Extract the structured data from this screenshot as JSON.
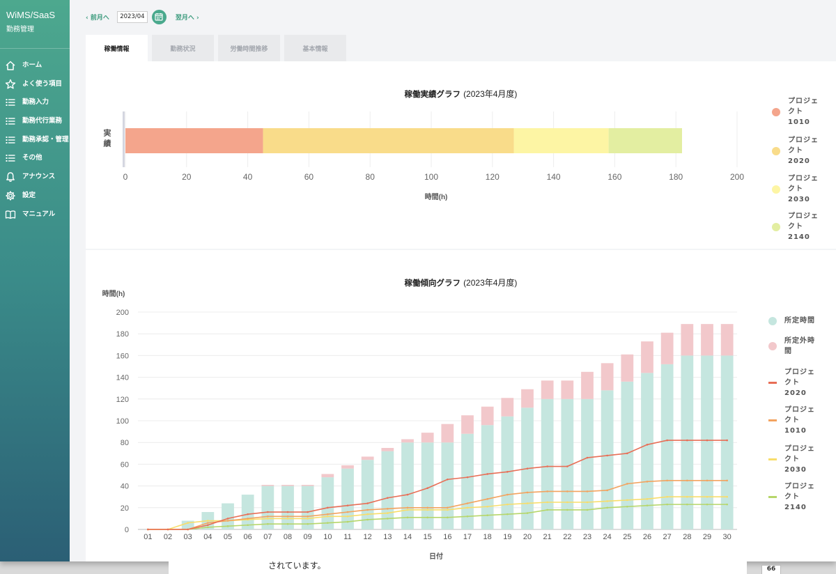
{
  "app": {
    "brand": "WiMS/SaaS",
    "subtitle": "勤務管理"
  },
  "sidebar": {
    "items": [
      {
        "label": "ホーム",
        "icon": "home-icon"
      },
      {
        "label": "よく使う項目",
        "icon": "star-icon"
      },
      {
        "label": "勤務入力",
        "icon": "list-icon"
      },
      {
        "label": "勤務代行業務",
        "icon": "list-icon"
      },
      {
        "label": "勤務承認・管理",
        "icon": "list-icon"
      },
      {
        "label": "その他",
        "icon": "list-icon"
      },
      {
        "label": "アナウンス",
        "icon": "bell-icon"
      },
      {
        "label": "設定",
        "icon": "gear-icon"
      },
      {
        "label": "マニュアル",
        "icon": "book-icon"
      }
    ]
  },
  "topbar": {
    "prev": "前月へ",
    "month": "2023/04",
    "next": "翌月へ"
  },
  "tabs": [
    "稼働情報",
    "勤務状況",
    "労働時間推移",
    "基本情報"
  ],
  "colors": {
    "accent": "#4aa98d",
    "p1010": "#f4a58c",
    "p2020": "#f9dc8a",
    "p2030": "#fdf5a4",
    "p2140": "#e3eea1",
    "scheduled": "#c5e6df",
    "overtime": "#f2c8cb"
  },
  "chart_data": [
    {
      "type": "bar",
      "orientation": "horizontal",
      "stacked": true,
      "title_bold": "稼働実績グラフ",
      "title_rest": "(2023年4月度)",
      "categories": [
        "実績"
      ],
      "series": [
        {
          "name": "プロジェクト1010",
          "values": [
            45
          ]
        },
        {
          "name": "プロジェクト2020",
          "values": [
            82
          ]
        },
        {
          "name": "プロジェクト2030",
          "values": [
            31
          ]
        },
        {
          "name": "プロジェクト2140",
          "values": [
            24
          ]
        }
      ],
      "xlabel": "時間(h)",
      "xlim": [
        0,
        200
      ],
      "xticks": [
        0,
        20,
        40,
        60,
        80,
        100,
        120,
        140,
        160,
        180,
        200
      ],
      "legend": "right"
    },
    {
      "type": "bar+line",
      "title_bold": "稼働傾向グラフ",
      "title_rest": "(2023年4月度)",
      "ylabel": "時間(h)",
      "xlabel": "日付",
      "ylim": [
        0,
        200
      ],
      "yticks": [
        0,
        20,
        40,
        60,
        80,
        100,
        120,
        140,
        160,
        180,
        200
      ],
      "categories": [
        "01",
        "02",
        "03",
        "04",
        "05",
        "06",
        "07",
        "08",
        "09",
        "10",
        "11",
        "12",
        "13",
        "14",
        "15",
        "16",
        "17",
        "18",
        "19",
        "20",
        "21",
        "22",
        "23",
        "24",
        "25",
        "26",
        "27",
        "28",
        "29",
        "30"
      ],
      "bars": [
        {
          "name": "所定時間",
          "values": [
            0,
            0,
            8,
            16,
            24,
            32,
            40,
            40,
            40,
            48,
            56,
            64,
            72,
            80,
            80,
            80,
            88,
            96,
            104,
            112,
            120,
            120,
            120,
            128,
            136,
            144,
            152,
            160,
            160,
            160
          ]
        },
        {
          "name": "所定外時間",
          "values": [
            0,
            0,
            0,
            0,
            0,
            0,
            1,
            1,
            1,
            3,
            3,
            3,
            3,
            3,
            9,
            17,
            17,
            17,
            17,
            17,
            17,
            17,
            25,
            25,
            25,
            29,
            29,
            29,
            29,
            29
          ]
        }
      ],
      "lines": [
        {
          "name": "プロジェクト2020",
          "values": [
            0,
            0,
            0,
            4,
            10,
            14,
            16,
            16,
            16,
            20,
            22,
            24,
            29,
            32,
            38,
            46,
            48,
            51,
            53,
            56,
            58,
            58,
            66,
            68,
            70,
            78,
            82,
            82,
            82,
            82
          ]
        },
        {
          "name": "プロジェクト1010",
          "values": [
            0,
            0,
            0,
            6,
            8,
            10,
            12,
            12,
            12,
            14,
            16,
            18,
            19,
            20,
            20,
            20,
            24,
            28,
            32,
            34,
            35,
            35,
            35,
            36,
            42,
            44,
            45,
            45,
            45,
            45
          ]
        },
        {
          "name": "プロジェクト2030",
          "values": [
            0,
            0,
            6,
            8,
            8,
            9,
            10,
            10,
            10,
            12,
            12,
            14,
            15,
            18,
            18,
            18,
            20,
            21,
            23,
            24,
            25,
            25,
            25,
            26,
            27,
            28,
            30,
            30,
            30,
            30
          ]
        },
        {
          "name": "プロジェクト2140",
          "values": [
            0,
            0,
            0,
            2,
            3,
            4,
            5,
            5,
            5,
            6,
            7,
            9,
            10,
            11,
            11,
            11,
            12,
            13,
            14,
            15,
            18,
            18,
            18,
            20,
            21,
            22,
            23,
            23,
            23,
            23
          ]
        }
      ],
      "legend": "right"
    }
  ],
  "legend1": [
    "プロジェクト1010",
    "プロジェクト2020",
    "プロジェクト2030",
    "プロジェクト2140"
  ],
  "legend2": [
    "所定時間",
    "所定外時間",
    "プロジェクト2020",
    "プロジェクト1010",
    "プロジェクト2030",
    "プロジェクト2140"
  ],
  "behind": {
    "text": "されています。",
    "page": "66"
  }
}
